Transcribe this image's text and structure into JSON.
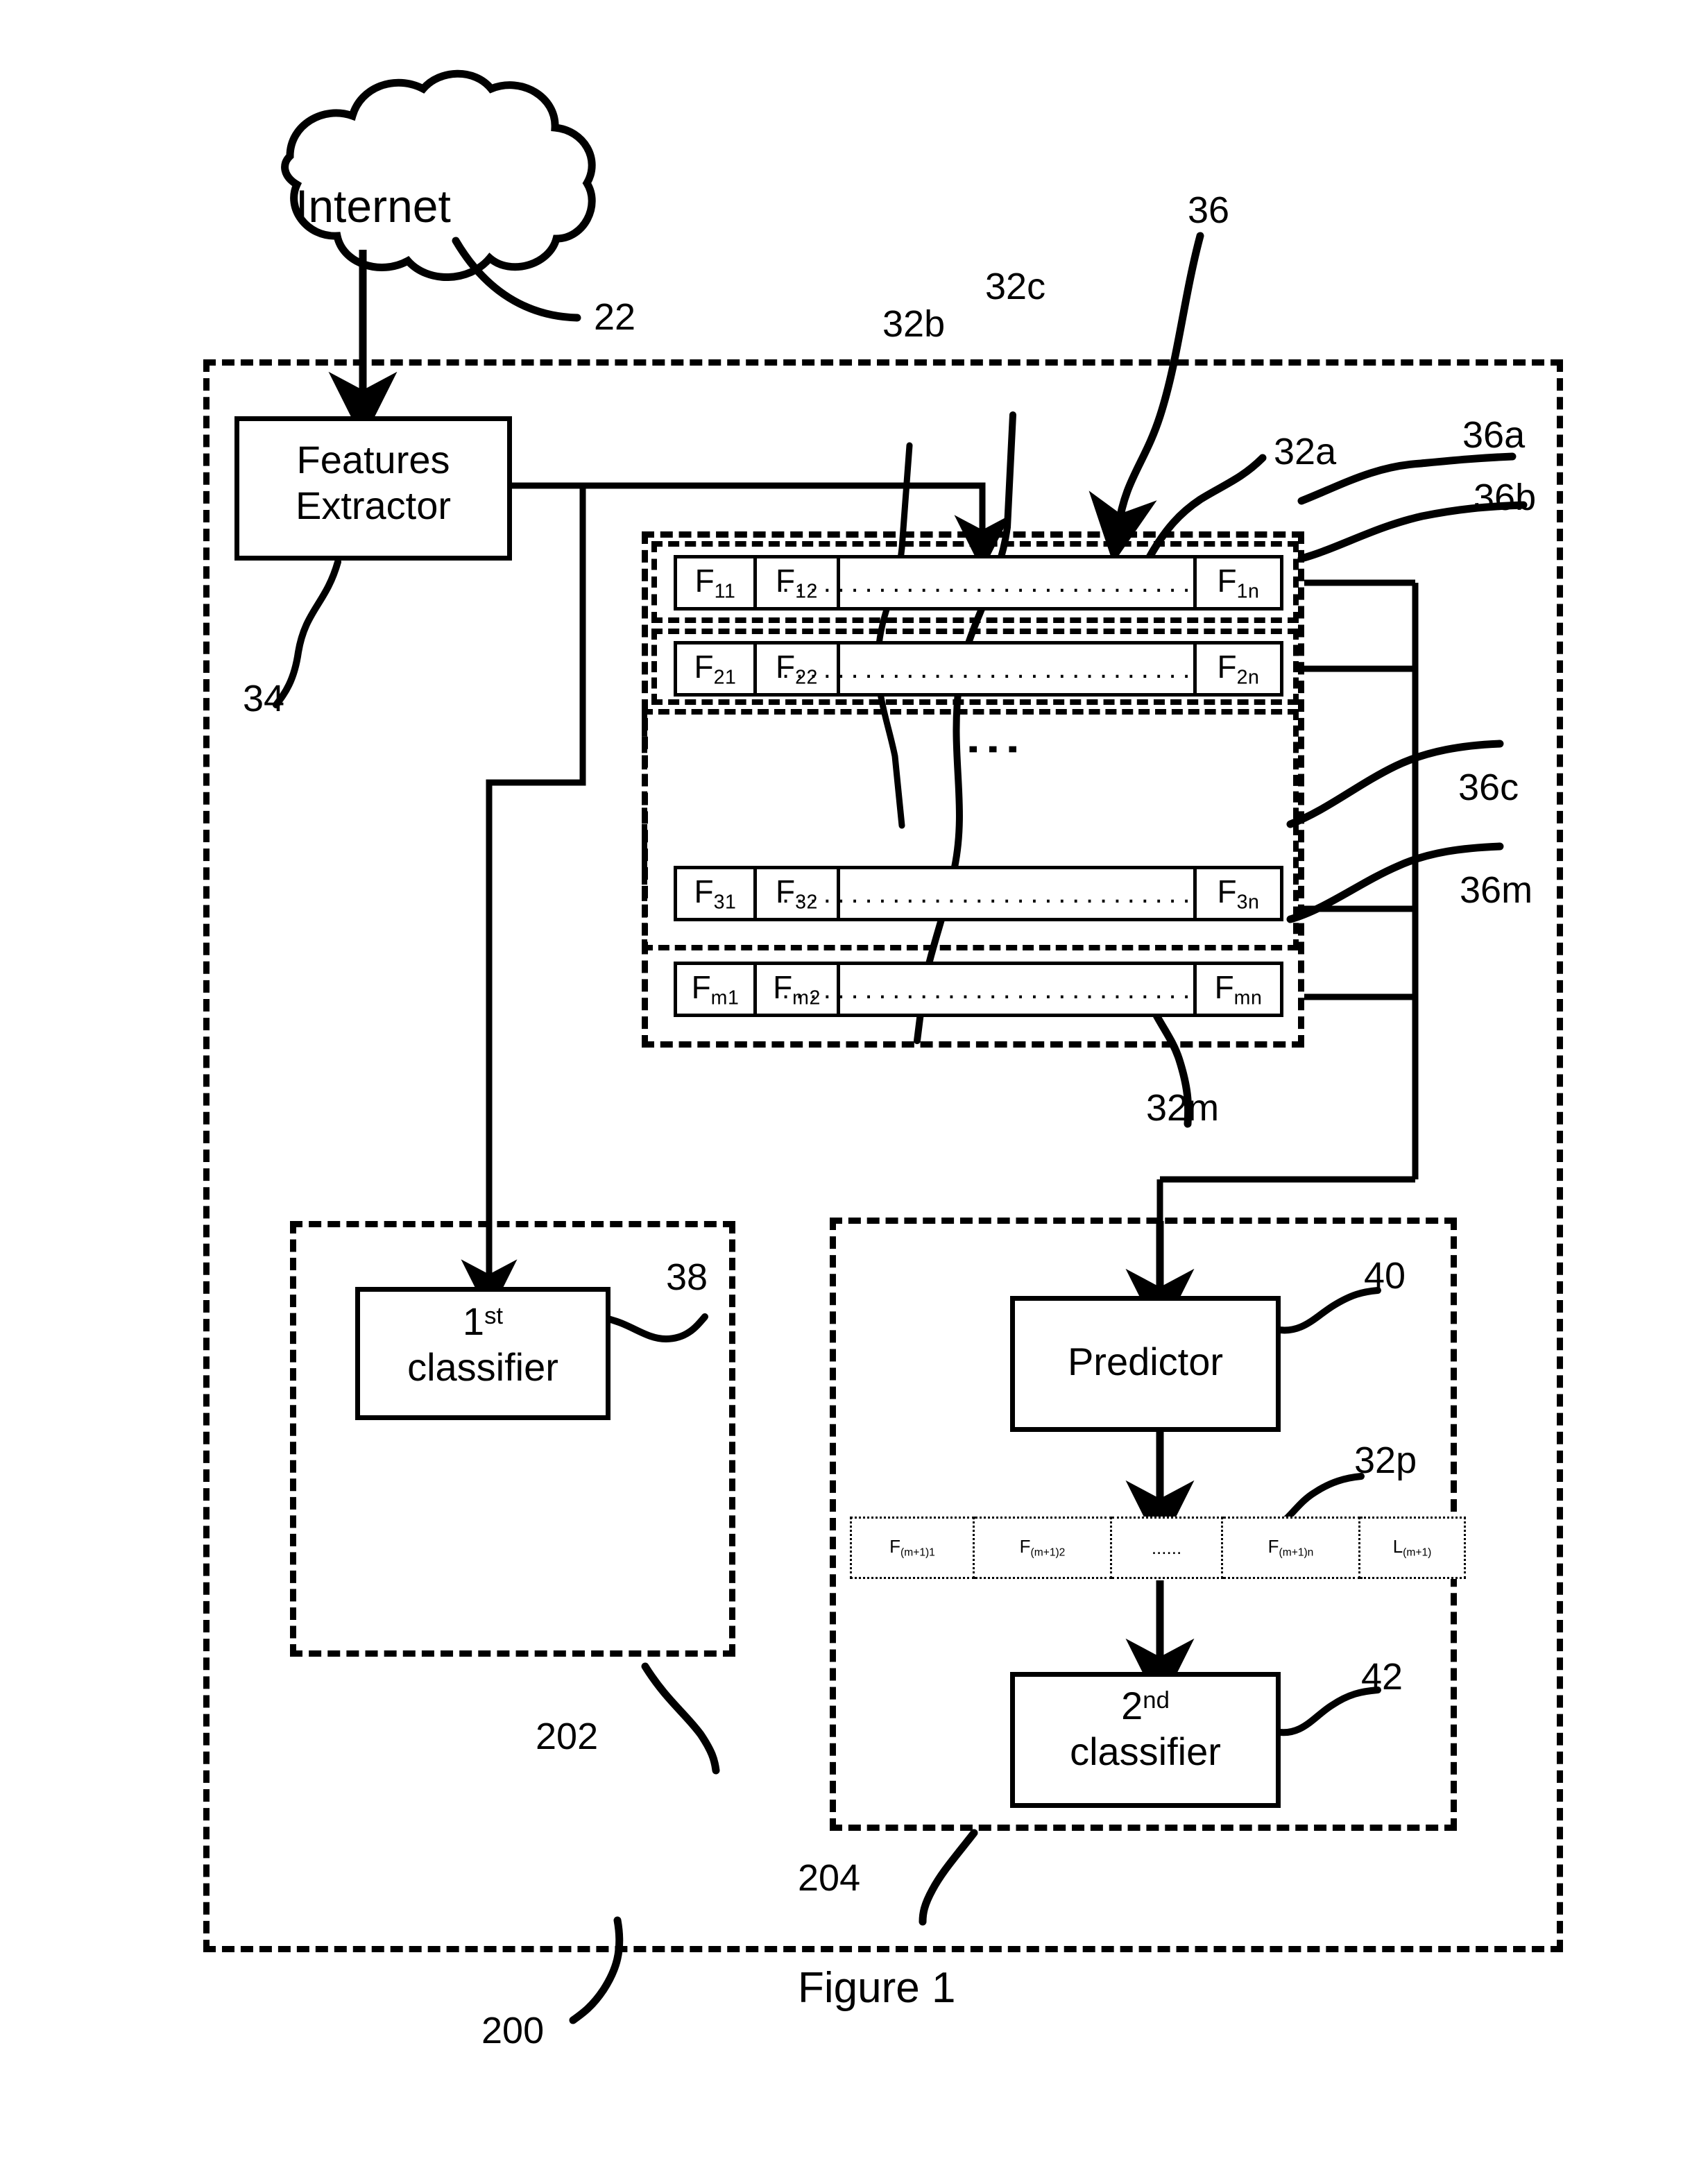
{
  "figure": {
    "caption": "Figure 1"
  },
  "cloud": {
    "label": "Internet",
    "ref": "22"
  },
  "system": {
    "ref": "200"
  },
  "branch_left": {
    "ref": "202"
  },
  "branch_right": {
    "ref": "204"
  },
  "features_extractor": {
    "label_line1": "Features",
    "label_line2": "Extractor",
    "ref": "34"
  },
  "first_classifier": {
    "ordinal": "1",
    "ordinal_suffix": "st",
    "label": "classifier",
    "ref": "38"
  },
  "predictor": {
    "label": "Predictor",
    "ref": "40"
  },
  "second_classifier": {
    "ordinal": "2",
    "ordinal_suffix": "nd",
    "label": "classifier",
    "ref": "42"
  },
  "matrix": {
    "ref": "36",
    "container_ref": "32a",
    "group_refs": [
      "32b",
      "32c",
      "32m"
    ],
    "row_refs_right": [
      "36a",
      "36b",
      "36c",
      "36m"
    ],
    "ellipsis_text": "..................................",
    "vertical_ellipsis": "⋮",
    "rows": [
      {
        "ref": "36a",
        "cells": [
          {
            "base": "F",
            "sub": "11"
          },
          {
            "base": "F",
            "sub": "12"
          },
          {
            "base": "",
            "sub": ""
          },
          {
            "base": "F",
            "sub": "1n"
          }
        ]
      },
      {
        "ref": "36b",
        "cells": [
          {
            "base": "F",
            "sub": "21"
          },
          {
            "base": "F",
            "sub": "22"
          },
          {
            "base": "",
            "sub": ""
          },
          {
            "base": "F",
            "sub": "2n"
          }
        ]
      },
      {
        "ref": "36c",
        "cells": [
          {
            "base": "F",
            "sub": "31"
          },
          {
            "base": "F",
            "sub": "32"
          },
          {
            "base": "",
            "sub": ""
          },
          {
            "base": "F",
            "sub": "3n"
          }
        ]
      },
      {
        "ref": "36m",
        "cells": [
          {
            "base": "F",
            "sub": "m1"
          },
          {
            "base": "F",
            "sub": "m2"
          },
          {
            "base": "",
            "sub": ""
          },
          {
            "base": "F",
            "sub": "mn"
          }
        ]
      }
    ]
  },
  "prediction_vector": {
    "ref": "32p",
    "cells": [
      {
        "base": "F",
        "sub": "(m+1)1"
      },
      {
        "base": "F",
        "sub": "(m+1)2"
      },
      {
        "base": "......",
        "sub": ""
      },
      {
        "base": "F",
        "sub": "(m+1)n"
      },
      {
        "base": "L",
        "sub": "(m+1)"
      }
    ]
  },
  "colors": {
    "ink": "#000000",
    "paper": "#ffffff"
  }
}
